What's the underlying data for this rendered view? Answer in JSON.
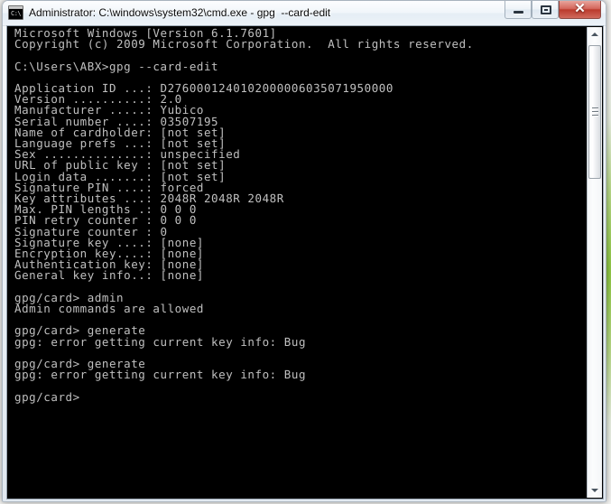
{
  "window": {
    "title": "Administrator: C:\\windows\\system32\\cmd.exe - gpg  --card-edit",
    "icon_name": "cmd-console-icon",
    "icon_glyph": "C:\\",
    "buttons": {
      "minimize_label": "–",
      "maximize_label": "□",
      "close_label": "✕"
    }
  },
  "console": {
    "prompt_user_path": "C:\\Users\\ABX",
    "card_prompt": "gpg/card>",
    "lines": [
      "Microsoft Windows [Version 6.1.7601]",
      "Copyright (c) 2009 Microsoft Corporation.  All rights reserved.",
      "",
      "C:\\Users\\ABX>gpg --card-edit",
      "",
      "Application ID ...: D2760001240102000006035071950000",
      "Version ..........: 2.0",
      "Manufacturer .....: Yubico",
      "Serial number ....: 03507195",
      "Name of cardholder: [not set]",
      "Language prefs ...: [not set]",
      "Sex ..............: unspecified",
      "URL of public key : [not set]",
      "Login data .......: [not set]",
      "Signature PIN ....: forced",
      "Key attributes ...: 2048R 2048R 2048R",
      "Max. PIN lengths .: 0 0 0",
      "PIN retry counter : 0 0 0",
      "Signature counter : 0",
      "Signature key ....: [none]",
      "Encryption key....: [none]",
      "Authentication key: [none]",
      "General key info..: [none]",
      "",
      "gpg/card> admin",
      "Admin commands are allowed",
      "",
      "gpg/card> generate",
      "gpg: error getting current key info: Bug",
      "",
      "gpg/card> generate",
      "gpg: error getting current key info: Bug",
      "",
      "gpg/card>"
    ],
    "card_info": {
      "application_id": "D2760001240102000006035071950000",
      "version": "2.0",
      "manufacturer": "Yubico",
      "serial_number": "03507195",
      "name_of_cardholder": "[not set]",
      "language_prefs": "[not set]",
      "sex": "unspecified",
      "url_of_public_key": "[not set]",
      "login_data": "[not set]",
      "signature_pin": "forced",
      "key_attributes": "2048R 2048R 2048R",
      "max_pin_lengths": "0 0 0",
      "pin_retry_counter": "0 0 0",
      "signature_counter": "0",
      "signature_key": "[none]",
      "encryption_key": "[none]",
      "authentication_key": "[none]",
      "general_key_info": "[none]"
    },
    "commands_entered": [
      "gpg --card-edit",
      "admin",
      "generate",
      "generate"
    ],
    "messages": [
      "Admin commands are allowed",
      "gpg: error getting current key info: Bug"
    ],
    "colors": {
      "background": "#000000",
      "foreground": "#c0c0c0"
    }
  },
  "scrollbar": {
    "up_arrow_label": "▲",
    "down_arrow_label": "▼"
  }
}
